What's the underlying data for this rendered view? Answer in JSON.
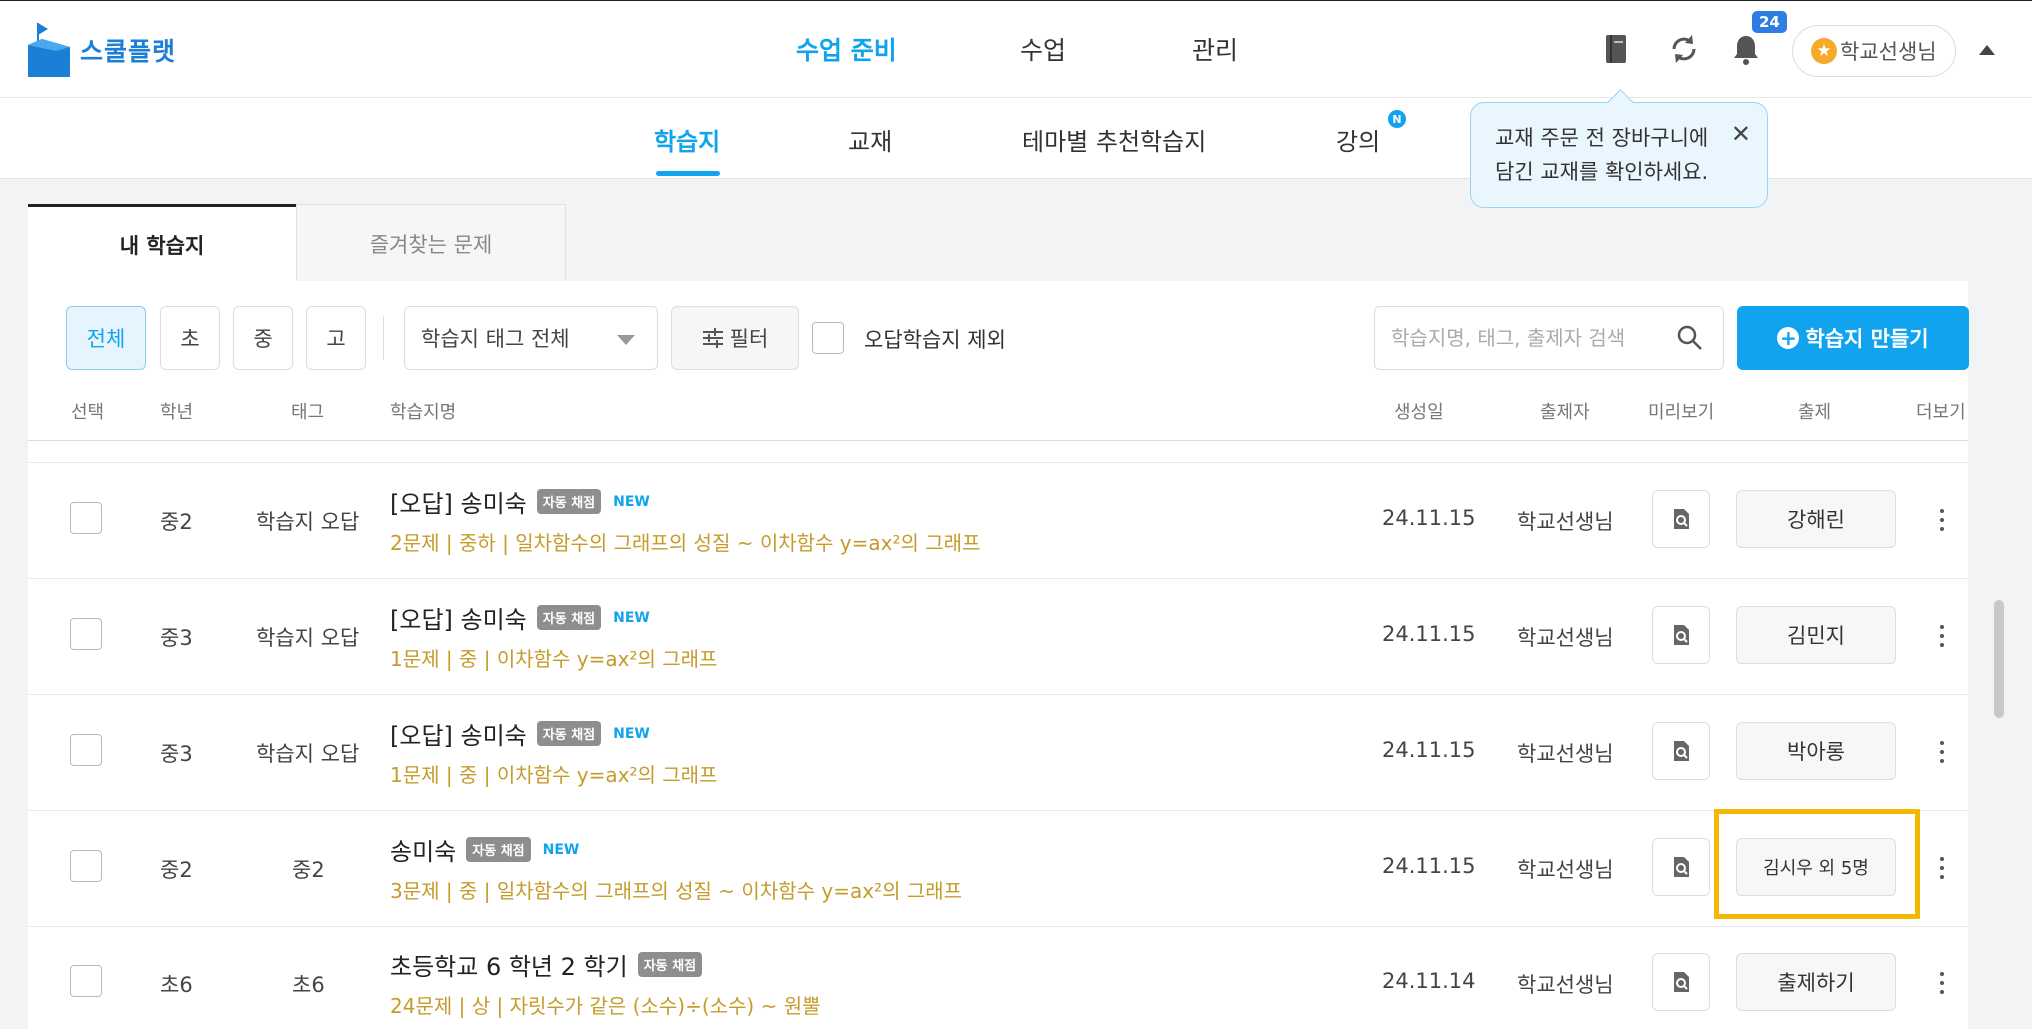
{
  "header": {
    "logo_text": "스쿨플랫",
    "nav": [
      {
        "label": "수업 준비",
        "active": true
      },
      {
        "label": "수업",
        "active": false
      },
      {
        "label": "관리",
        "active": false
      }
    ],
    "notification_count": "24",
    "user_name": "학교선생님",
    "accent_color": "#12a3ee"
  },
  "subnav": {
    "items": [
      {
        "label": "학습지",
        "active": true
      },
      {
        "label": "교재",
        "active": false
      },
      {
        "label": "테마별 추천학습지",
        "active": false
      },
      {
        "label": "강의",
        "active": false
      }
    ],
    "new_dot": "N"
  },
  "tooltip": {
    "line1": "교재 주문 전 장바구니에",
    "line2": "담긴 교재를 확인하세요.",
    "close": "✕"
  },
  "tabs": {
    "my": "내 학습지",
    "favorites": "즐겨찾는 문제"
  },
  "toolbar": {
    "grades": [
      "전체",
      "초",
      "중",
      "고"
    ],
    "tag_select": "학습지 태그 전체",
    "filter": "필터",
    "exclude_wrong": "오답학습지 제외",
    "search_placeholder": "학습지명, 태그, 출제자 검색",
    "create": "학습지 만들기"
  },
  "table": {
    "columns": [
      "선택",
      "학년",
      "태그",
      "학습지명",
      "생성일",
      "출제자",
      "미리보기",
      "출제",
      "더보기"
    ],
    "rows": [
      {
        "grade": "중2",
        "tag": "학습지 오답",
        "title": "[오답] 송미숙",
        "auto": "자동 채점",
        "new": "NEW",
        "sub": "2문제 | 중하 | 일차함수의 그래프의 성질 ~ 이차함수 y=ax²의 그래프",
        "date": "24.11.15",
        "author": "학교선생님",
        "assign": "강해린"
      },
      {
        "grade": "중3",
        "tag": "학습지 오답",
        "title": "[오답] 송미숙",
        "auto": "자동 채점",
        "new": "NEW",
        "sub": "1문제 | 중 | 이차함수 y=ax²의 그래프",
        "date": "24.11.15",
        "author": "학교선생님",
        "assign": "김민지"
      },
      {
        "grade": "중3",
        "tag": "학습지 오답",
        "title": "[오답] 송미숙",
        "auto": "자동 채점",
        "new": "NEW",
        "sub": "1문제 | 중 | 이차함수 y=ax²의 그래프",
        "date": "24.11.15",
        "author": "학교선생님",
        "assign": "박아롱"
      },
      {
        "grade": "중2",
        "tag": "중2",
        "title": "송미숙",
        "auto": "자동 채점",
        "new": "NEW",
        "sub": "3문제 | 중 | 일차함수의 그래프의 성질 ~ 이차함수 y=ax²의 그래프",
        "date": "24.11.15",
        "author": "학교선생님",
        "assign": "김시우 외 5명"
      },
      {
        "grade": "초6",
        "tag": "초6",
        "title": "초등학교 6 학년 2 학기",
        "auto": "자동 채점",
        "new": "",
        "sub": "24문제 | 상 | 자릿수가 같은 (소수)÷(소수) ~ 원뿔",
        "date": "24.11.14",
        "author": "학교선생님",
        "assign": "출제하기"
      }
    ]
  }
}
